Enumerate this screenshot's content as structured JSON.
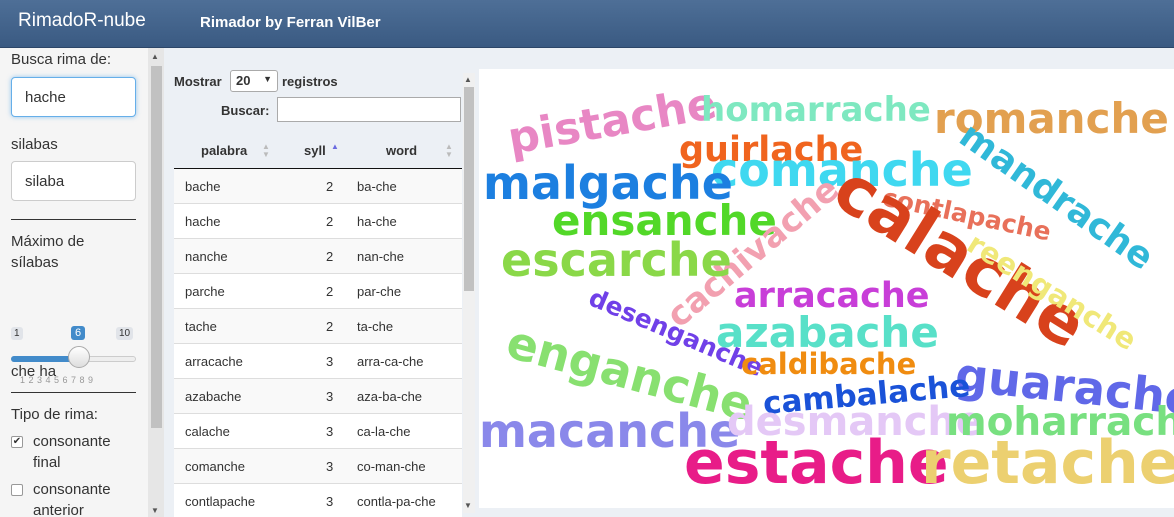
{
  "navbar": {
    "brand": "RimadoR-nube",
    "subtitle": "Rimador by Ferran VilBer"
  },
  "sidebar": {
    "search_label": "Busca rima de:",
    "search_value": "hache",
    "syllables_label": "silabas",
    "syllables_value": "silaba",
    "max_label_line1": "Máximo de",
    "max_label_line2": "sílabas",
    "slider": {
      "min": "1",
      "max": "10",
      "value": "6",
      "ticks": "1 2 3 4 5 6 7 8 9"
    },
    "syllable_output": "che ha",
    "rhyme_type_label": "Tipo de rima:",
    "options": [
      {
        "label_line1": "consonante",
        "label_line2": "final",
        "checked": true
      },
      {
        "label_line1": "consonante",
        "label_line2": "anterior",
        "checked": false
      }
    ]
  },
  "table": {
    "show_label": "Mostrar",
    "page_length": "20",
    "records_label": "registros",
    "search_label": "Buscar:",
    "columns": [
      "palabra",
      "syll",
      "word"
    ],
    "rows": [
      {
        "palabra": "bache",
        "syll": "2",
        "word": "ba-che"
      },
      {
        "palabra": "hache",
        "syll": "2",
        "word": "ha-che"
      },
      {
        "palabra": "nanche",
        "syll": "2",
        "word": "nan-che"
      },
      {
        "palabra": "parche",
        "syll": "2",
        "word": "par-che"
      },
      {
        "palabra": "tache",
        "syll": "2",
        "word": "ta-che"
      },
      {
        "palabra": "arracache",
        "syll": "3",
        "word": "arra-ca-che"
      },
      {
        "palabra": "azabache",
        "syll": "3",
        "word": "aza-ba-che"
      },
      {
        "palabra": "calache",
        "syll": "3",
        "word": "ca-la-che"
      },
      {
        "palabra": "comanche",
        "syll": "3",
        "word": "co-man-che"
      },
      {
        "palabra": "contlapache",
        "syll": "3",
        "word": "contla-pa-che"
      }
    ]
  },
  "cloud": {
    "words": [
      {
        "text": "pistache",
        "color": "#e887c4"
      },
      {
        "text": "homarrache",
        "color": "#7ee8c0"
      },
      {
        "text": "romanche",
        "color": "#e2a050"
      },
      {
        "text": "guirlache",
        "color": "#f0641e"
      },
      {
        "text": "comanche",
        "color": "#3fd8f0"
      },
      {
        "text": "malgache",
        "color": "#1c7fe0"
      },
      {
        "text": "mandrache",
        "color": "#30b8d8"
      },
      {
        "text": "ensanche",
        "color": "#52d828"
      },
      {
        "text": "contlapache",
        "color": "#e8705a"
      },
      {
        "text": "calache",
        "color": "#d8421c"
      },
      {
        "text": "cachivache",
        "color": "#f2a0b0"
      },
      {
        "text": "escarche",
        "color": "#8ad848"
      },
      {
        "text": "reenganche",
        "color": "#f0e878"
      },
      {
        "text": "arracache",
        "color": "#c83ed8"
      },
      {
        "text": "desenganche",
        "color": "#7040e8"
      },
      {
        "text": "azabache",
        "color": "#58e0c8"
      },
      {
        "text": "enganche",
        "color": "#88e070"
      },
      {
        "text": "caldibache",
        "color": "#f08c10"
      },
      {
        "text": "guarache",
        "color": "#6068e8"
      },
      {
        "text": "cambalache",
        "color": "#1a52d8"
      },
      {
        "text": "macanche",
        "color": "#8a88ea"
      },
      {
        "text": "desmanche",
        "color": "#e4c8f6"
      },
      {
        "text": "moharrache",
        "color": "#78e080"
      },
      {
        "text": "estache",
        "color": "#e81c88"
      },
      {
        "text": "retache",
        "color": "#ecd070"
      }
    ]
  }
}
